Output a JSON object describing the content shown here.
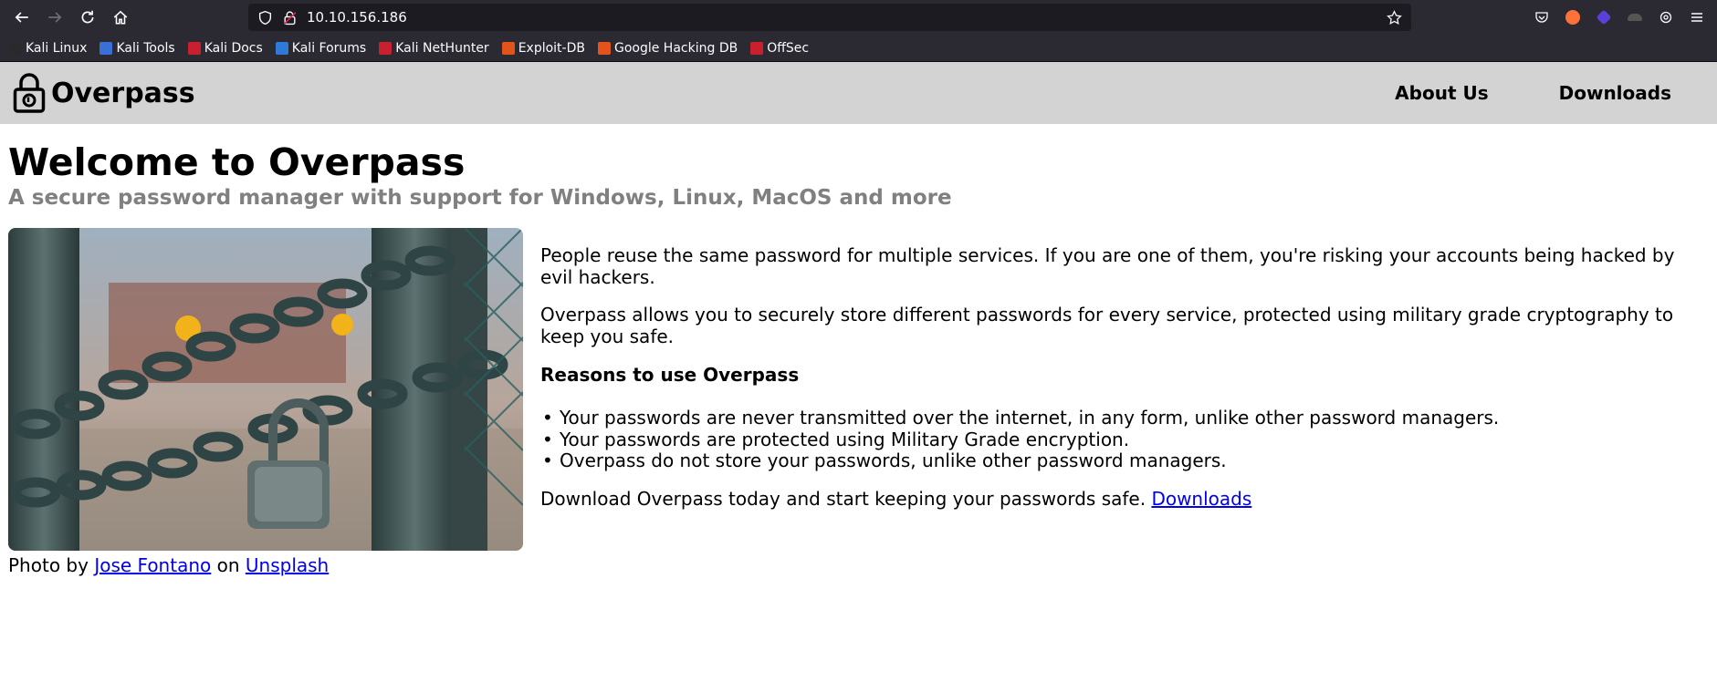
{
  "browser": {
    "url": "10.10.156.186",
    "bookmarks": [
      {
        "label": "Kali Linux",
        "color": "#2a2a2a"
      },
      {
        "label": "Kali Tools",
        "color": "#3b6fd8"
      },
      {
        "label": "Kali Docs",
        "color": "#c8202f"
      },
      {
        "label": "Kali Forums",
        "color": "#2f7ad8"
      },
      {
        "label": "Kali NetHunter",
        "color": "#c8202f"
      },
      {
        "label": "Exploit-DB",
        "color": "#e2541c"
      },
      {
        "label": "Google Hacking DB",
        "color": "#e2541c"
      },
      {
        "label": "OffSec",
        "color": "#c8202f"
      }
    ]
  },
  "header": {
    "brand": "Overpass",
    "nav": [
      "About Us",
      "Downloads"
    ]
  },
  "main": {
    "title": "Welcome to Overpass",
    "subtitle": "A secure password manager with support for Windows, Linux, MacOS and more",
    "photo_credit": {
      "prefix": "Photo by",
      "author": "Jose Fontano",
      "middle": "on",
      "site": "Unsplash"
    },
    "paragraph1": "People reuse the same password for multiple services. If you are one of them, you're risking your accounts being hacked by evil hackers.",
    "paragraph2": "Overpass allows you to securely store different passwords for every service, protected using military grade cryptography to keep you safe.",
    "reasons_heading": "Reasons to use Overpass",
    "reasons": [
      "Your passwords are never transmitted over the internet, in any form, unlike other password managers.",
      "Your passwords are protected using Military Grade encryption.",
      "Overpass do not store your passwords, unlike other password managers."
    ],
    "cta_text": "Download Overpass today and start keeping your passwords safe.",
    "cta_link": "Downloads"
  }
}
